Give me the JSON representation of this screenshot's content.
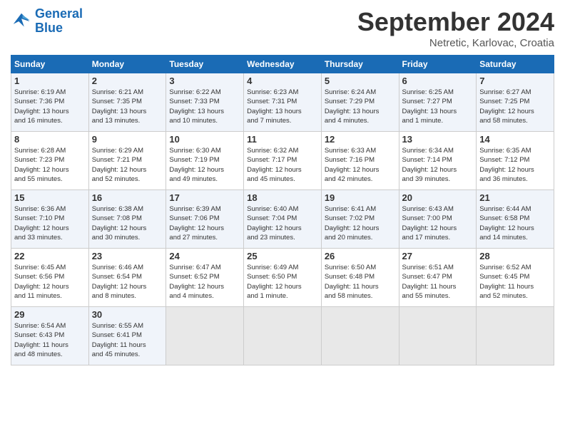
{
  "header": {
    "logo_line1": "General",
    "logo_line2": "Blue",
    "month": "September 2024",
    "location": "Netretic, Karlovac, Croatia"
  },
  "days_of_week": [
    "Sunday",
    "Monday",
    "Tuesday",
    "Wednesday",
    "Thursday",
    "Friday",
    "Saturday"
  ],
  "weeks": [
    [
      {
        "day": 1,
        "info": "Sunrise: 6:19 AM\nSunset: 7:36 PM\nDaylight: 13 hours\nand 16 minutes."
      },
      {
        "day": 2,
        "info": "Sunrise: 6:21 AM\nSunset: 7:35 PM\nDaylight: 13 hours\nand 13 minutes."
      },
      {
        "day": 3,
        "info": "Sunrise: 6:22 AM\nSunset: 7:33 PM\nDaylight: 13 hours\nand 10 minutes."
      },
      {
        "day": 4,
        "info": "Sunrise: 6:23 AM\nSunset: 7:31 PM\nDaylight: 13 hours\nand 7 minutes."
      },
      {
        "day": 5,
        "info": "Sunrise: 6:24 AM\nSunset: 7:29 PM\nDaylight: 13 hours\nand 4 minutes."
      },
      {
        "day": 6,
        "info": "Sunrise: 6:25 AM\nSunset: 7:27 PM\nDaylight: 13 hours\nand 1 minute."
      },
      {
        "day": 7,
        "info": "Sunrise: 6:27 AM\nSunset: 7:25 PM\nDaylight: 12 hours\nand 58 minutes."
      }
    ],
    [
      {
        "day": 8,
        "info": "Sunrise: 6:28 AM\nSunset: 7:23 PM\nDaylight: 12 hours\nand 55 minutes."
      },
      {
        "day": 9,
        "info": "Sunrise: 6:29 AM\nSunset: 7:21 PM\nDaylight: 12 hours\nand 52 minutes."
      },
      {
        "day": 10,
        "info": "Sunrise: 6:30 AM\nSunset: 7:19 PM\nDaylight: 12 hours\nand 49 minutes."
      },
      {
        "day": 11,
        "info": "Sunrise: 6:32 AM\nSunset: 7:17 PM\nDaylight: 12 hours\nand 45 minutes."
      },
      {
        "day": 12,
        "info": "Sunrise: 6:33 AM\nSunset: 7:16 PM\nDaylight: 12 hours\nand 42 minutes."
      },
      {
        "day": 13,
        "info": "Sunrise: 6:34 AM\nSunset: 7:14 PM\nDaylight: 12 hours\nand 39 minutes."
      },
      {
        "day": 14,
        "info": "Sunrise: 6:35 AM\nSunset: 7:12 PM\nDaylight: 12 hours\nand 36 minutes."
      }
    ],
    [
      {
        "day": 15,
        "info": "Sunrise: 6:36 AM\nSunset: 7:10 PM\nDaylight: 12 hours\nand 33 minutes."
      },
      {
        "day": 16,
        "info": "Sunrise: 6:38 AM\nSunset: 7:08 PM\nDaylight: 12 hours\nand 30 minutes."
      },
      {
        "day": 17,
        "info": "Sunrise: 6:39 AM\nSunset: 7:06 PM\nDaylight: 12 hours\nand 27 minutes."
      },
      {
        "day": 18,
        "info": "Sunrise: 6:40 AM\nSunset: 7:04 PM\nDaylight: 12 hours\nand 23 minutes."
      },
      {
        "day": 19,
        "info": "Sunrise: 6:41 AM\nSunset: 7:02 PM\nDaylight: 12 hours\nand 20 minutes."
      },
      {
        "day": 20,
        "info": "Sunrise: 6:43 AM\nSunset: 7:00 PM\nDaylight: 12 hours\nand 17 minutes."
      },
      {
        "day": 21,
        "info": "Sunrise: 6:44 AM\nSunset: 6:58 PM\nDaylight: 12 hours\nand 14 minutes."
      }
    ],
    [
      {
        "day": 22,
        "info": "Sunrise: 6:45 AM\nSunset: 6:56 PM\nDaylight: 12 hours\nand 11 minutes."
      },
      {
        "day": 23,
        "info": "Sunrise: 6:46 AM\nSunset: 6:54 PM\nDaylight: 12 hours\nand 8 minutes."
      },
      {
        "day": 24,
        "info": "Sunrise: 6:47 AM\nSunset: 6:52 PM\nDaylight: 12 hours\nand 4 minutes."
      },
      {
        "day": 25,
        "info": "Sunrise: 6:49 AM\nSunset: 6:50 PM\nDaylight: 12 hours\nand 1 minute."
      },
      {
        "day": 26,
        "info": "Sunrise: 6:50 AM\nSunset: 6:48 PM\nDaylight: 11 hours\nand 58 minutes."
      },
      {
        "day": 27,
        "info": "Sunrise: 6:51 AM\nSunset: 6:47 PM\nDaylight: 11 hours\nand 55 minutes."
      },
      {
        "day": 28,
        "info": "Sunrise: 6:52 AM\nSunset: 6:45 PM\nDaylight: 11 hours\nand 52 minutes."
      }
    ],
    [
      {
        "day": 29,
        "info": "Sunrise: 6:54 AM\nSunset: 6:43 PM\nDaylight: 11 hours\nand 48 minutes."
      },
      {
        "day": 30,
        "info": "Sunrise: 6:55 AM\nSunset: 6:41 PM\nDaylight: 11 hours\nand 45 minutes."
      },
      null,
      null,
      null,
      null,
      null
    ]
  ]
}
